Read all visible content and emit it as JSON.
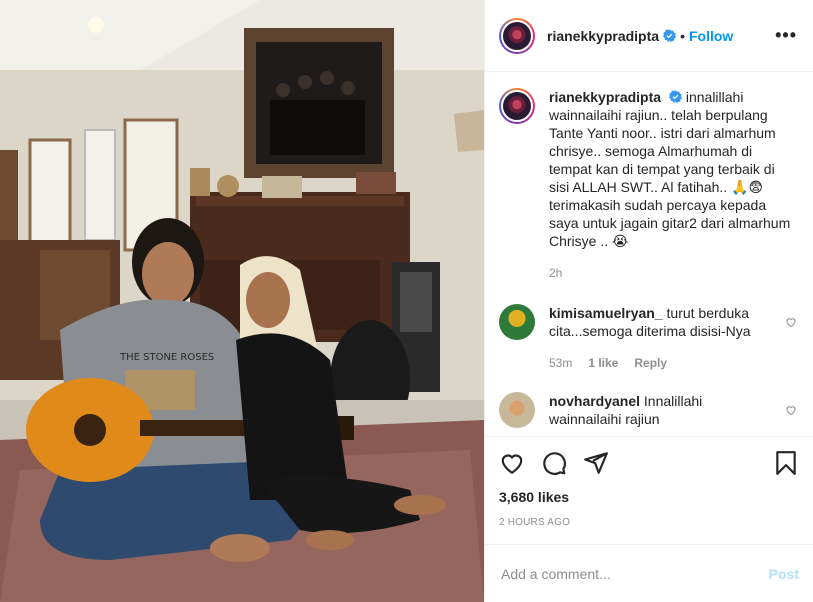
{
  "post": {
    "username": "rianekkypradipta",
    "follow_label": "Follow",
    "more_icon": "more-icon"
  },
  "caption": {
    "username": "rianekkypradipta",
    "text": "innalillahi wainnailaihi rajiun.. telah berpulang Tante Yanti noor.. istri dari almarhum chrisye.. semoga Almarhumah di tempat kan di tempat yang terbaik di sisi ALLAH SWT.. Al fatihah.. 🙏😨 terimakasih sudah percaya kepada saya untuk jagain gitar2 dari almarhum Chrisye .. 😭",
    "time": "2h"
  },
  "comments": [
    {
      "username": "kimisamuelryan_",
      "text": "turut berduka cita...semoga diterima disisi-Nya",
      "time": "53m",
      "likes": "1 like",
      "reply": "Reply"
    },
    {
      "username": "novhardyanel",
      "text": "Innalillahi wainnailaihi rajiun"
    }
  ],
  "stats": {
    "likes": "3,680 likes",
    "posted": "2 HOURS AGO"
  },
  "comment_box": {
    "placeholder": "Add a comment...",
    "post_label": "Post"
  },
  "colors": {
    "accent": "#0095f6",
    "muted": "#8e8e8e",
    "post_disabled": "#b2dffc"
  }
}
